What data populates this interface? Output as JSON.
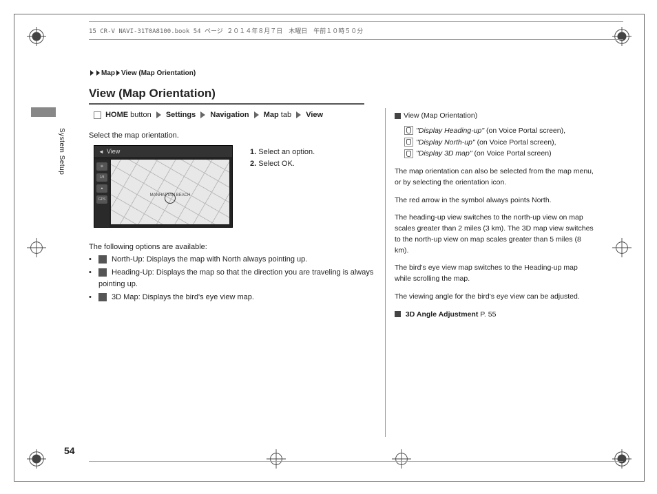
{
  "header_line": "15 CR-V NAVI-31T0A8100.book  54 ページ  ２０１４年８月７日　木曜日　午前１０時５０分",
  "breadcrumb": {
    "a": "Map",
    "b": "View (Map Orientation)"
  },
  "title": "View (Map Orientation)",
  "sidebar": "System Setup",
  "nav": {
    "home": "HOME",
    "button_word": "button",
    "settings": "Settings",
    "navigation": "Navigation",
    "map": "Map",
    "tab_word": "tab",
    "view": "View"
  },
  "intro": "Select the map orientation.",
  "screenshot": {
    "title": "View",
    "map_label": "MANHATTAN BEACH",
    "side1": "1/8",
    "side2": "GPS"
  },
  "steps": {
    "s1n": "1.",
    "s1": "Select an option.",
    "s2n": "2.",
    "s2t": "Select ",
    "s2b": "OK",
    "s2d": "."
  },
  "options_intro": "The following options are available:",
  "options": [
    " North-Up: Displays the map with North always pointing up.",
    " Heading-Up: Displays the map so that the direction you are traveling is always pointing up.",
    " 3D Map: Displays the bird's eye view map."
  ],
  "right": {
    "title": "View (Map Orientation)",
    "voice": [
      {
        "t": "Display Heading-up",
        "suffix": " (on Voice Portal screen),"
      },
      {
        "t": "Display North-up",
        "suffix": " (on Voice Portal screen),"
      },
      {
        "t": "Display 3D map",
        "suffix": " (on Voice Portal screen)"
      }
    ],
    "p1": "The map orientation can also be selected from the map menu, or by selecting the orientation icon.",
    "p2": "The red arrow in the symbol always points North.",
    "p3": "The heading-up view switches to the north-up view on map scales greater than 2 miles (3 km). The 3D map view switches to the north-up view on map scales greater than 5 miles (8 km).",
    "p4": "The bird's eye view map switches to the Heading-up map while scrolling the map.",
    "p5": "The viewing angle for the bird's eye view can be adjusted.",
    "xref": "3D Angle Adjustment",
    "xref_page": " P. 55"
  },
  "page_number": "54"
}
